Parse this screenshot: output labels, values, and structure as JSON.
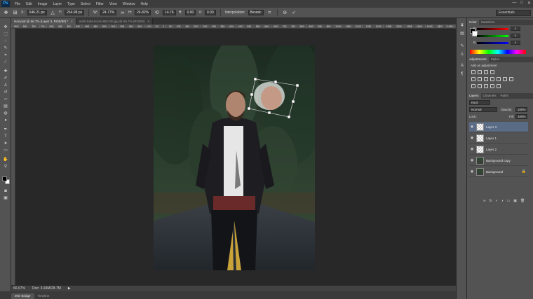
{
  "app": {
    "logo": "Ps"
  },
  "menu": [
    "File",
    "Edit",
    "Image",
    "Layer",
    "Type",
    "Select",
    "Filter",
    "View",
    "Window",
    "Help"
  ],
  "window_controls": [
    "—",
    "□",
    "✕"
  ],
  "options": {
    "x": "646.21 px",
    "y": "264.98 px",
    "w": "24.77%",
    "h": "24.82%",
    "angle": "14.76",
    "hskew": "0.00",
    "vskew": "0.00",
    "interp_label": "Interpolation:",
    "interp_value": "Bicubic",
    "workspace": "Essentials"
  },
  "tabs": [
    {
      "label": "Hair.psd @ 66.7% (Layer 3, RGB/8#) *",
      "close": "×",
      "active": true
    },
    {
      "label": "adult-bald-boots-952130.jpg @ 66.7% (RGB/8)",
      "close": "×",
      "active": false
    }
  ],
  "ruler_labels": [
    "850",
    "800",
    "750",
    "700",
    "650",
    "600",
    "550",
    "500",
    "450",
    "400",
    "350",
    "300",
    "250",
    "200",
    "150",
    "100",
    "50",
    "0",
    "50",
    "100",
    "150",
    "200",
    "250",
    "300",
    "350",
    "400",
    "450",
    "500",
    "550",
    "600",
    "650",
    "700",
    "750",
    "800",
    "850",
    "900",
    "950",
    "1000",
    "1050",
    "1100",
    "1150",
    "1200",
    "1250",
    "1300",
    "1350",
    "1400",
    "1450",
    "1500",
    "1550"
  ],
  "status": {
    "zoom": "66.67%",
    "doc": "Doc: 3.94M/28.7M",
    "arrow": "▶"
  },
  "bottom_tabs": [
    "Mini Bridge",
    "Timeline"
  ],
  "panels": {
    "color": {
      "tabs": [
        "Color",
        "Swatches"
      ],
      "channels": [
        {
          "label": "R",
          "value": "0"
        },
        {
          "label": "G",
          "value": "0"
        },
        {
          "label": "B",
          "value": "0"
        }
      ]
    },
    "adjustments": {
      "tabs": [
        "Adjustments",
        "Styles"
      ],
      "caption": "Add an adjustment"
    },
    "layers": {
      "tabs": [
        "Layers",
        "Channels",
        "Paths"
      ],
      "kind": "Kind",
      "blend": "Normal",
      "opacity_label": "Opacity:",
      "opacity": "100%",
      "lock_label": "Lock:",
      "fill_label": "Fill:",
      "fill": "100%",
      "items": [
        {
          "name": "Layer 3",
          "thumb": "trans",
          "active": true,
          "lock": ""
        },
        {
          "name": "Layer 1",
          "thumb": "trans",
          "active": false,
          "lock": ""
        },
        {
          "name": "Layer 2",
          "thumb": "trans",
          "active": false,
          "lock": ""
        },
        {
          "name": "Background copy",
          "thumb": "img",
          "active": false,
          "lock": ""
        },
        {
          "name": "Background",
          "thumb": "img",
          "active": false,
          "lock": "🔒"
        }
      ],
      "footer": [
        "∞",
        "fx",
        "◐",
        "◑",
        "▭",
        "▣",
        "🗑"
      ]
    }
  },
  "colors": {
    "accent": "#5a6b85",
    "panel": "#535353",
    "canvas": "#282828"
  }
}
